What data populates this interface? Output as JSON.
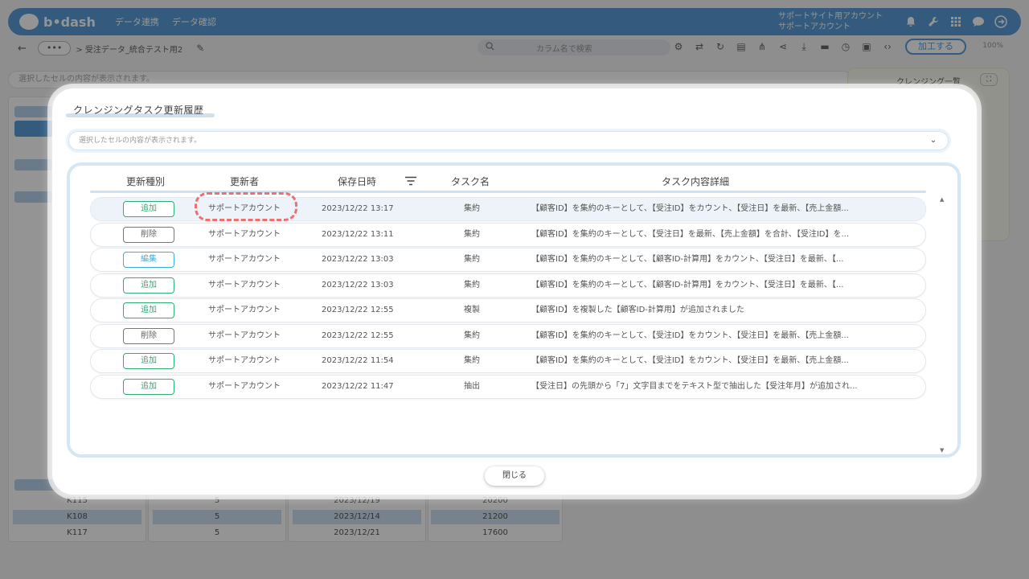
{
  "app": {
    "logo_text": "b•dash",
    "nav": [
      "データ連携",
      "データ確認"
    ],
    "account_line1": "サポートサイト用アカウント",
    "account_line2": "サポートアカウント",
    "icons": [
      "bell-icon",
      "wrench-icon",
      "grid-icon",
      "chat-icon",
      "logout-icon"
    ]
  },
  "toolbar": {
    "more_label": "•••",
    "breadcrumb": "> 受注データ_統合テスト用2",
    "search_placeholder": "カラム名で検索",
    "process_label": "加工する",
    "zoom": "100%"
  },
  "cell_bar_text": "選択したセルの内容が表示されます。",
  "cleansing_panel_title": "クレンジング一覧",
  "bg_table": {
    "rows": [
      [
        "K115",
        "5",
        "2023/12/19",
        "20200"
      ],
      [
        "K108",
        "5",
        "2023/12/14",
        "21200"
      ],
      [
        "K117",
        "5",
        "2023/12/21",
        "17600"
      ]
    ]
  },
  "modal": {
    "title": "クレンジングタスク更新履歴",
    "cell_bar_placeholder": "選択したセルの内容が表示されます。",
    "columns": {
      "type": "更新種別",
      "updater": "更新者",
      "saved_at": "保存日時",
      "task_name": "タスク名",
      "detail": "タスク内容詳細"
    },
    "rows": [
      {
        "type": "追加",
        "updater": "サポートアカウント",
        "saved_at": "2023/12/22 13:17",
        "task_name": "集約",
        "detail": "【顧客ID】を集約のキーとして、【受注ID】をカウント、【受注日】を最新、【売上金額..."
      },
      {
        "type": "削除",
        "updater": "サポートアカウント",
        "saved_at": "2023/12/22 13:11",
        "task_name": "集約",
        "detail": "【顧客ID】を集約のキーとして、【受注日】を最新、【売上金額】を合計、【受注ID】を..."
      },
      {
        "type": "編集",
        "updater": "サポートアカウント",
        "saved_at": "2023/12/22 13:03",
        "task_name": "集約",
        "detail": "【顧客ID】を集約のキーとして、【顧客ID-計算用】をカウント、【受注日】を最新、【..."
      },
      {
        "type": "追加",
        "updater": "サポートアカウント",
        "saved_at": "2023/12/22 13:03",
        "task_name": "集約",
        "detail": "【顧客ID】を集約のキーとして、【顧客ID-計算用】をカウント、【受注日】を最新、【..."
      },
      {
        "type": "追加",
        "updater": "サポートアカウント",
        "saved_at": "2023/12/22 12:55",
        "task_name": "複製",
        "detail": "【顧客ID】を複製した【顧客ID-計算用】が追加されました"
      },
      {
        "type": "削除",
        "updater": "サポートアカウント",
        "saved_at": "2023/12/22 12:55",
        "task_name": "集約",
        "detail": "【顧客ID】を集約のキーとして、【受注ID】をカウント、【受注日】を最新、【売上金額..."
      },
      {
        "type": "追加",
        "updater": "サポートアカウント",
        "saved_at": "2023/12/22 11:54",
        "task_name": "集約",
        "detail": "【顧客ID】を集約のキーとして、【受注ID】をカウント、【受注日】を最新、【売上金額..."
      },
      {
        "type": "追加",
        "updater": "サポートアカウント",
        "saved_at": "2023/12/22 11:47",
        "task_name": "抽出",
        "detail": "【受注日】の先頭から「7」文字目までをテキスト型で抽出した【受注年月】が追加され..."
      }
    ],
    "close_label": "閉じる"
  },
  "colors": {
    "accent": "#5a9ed9",
    "add": "#2fae74",
    "edit": "#3aaee0",
    "delete": "#777777",
    "highlight": "#ee6f6f"
  }
}
